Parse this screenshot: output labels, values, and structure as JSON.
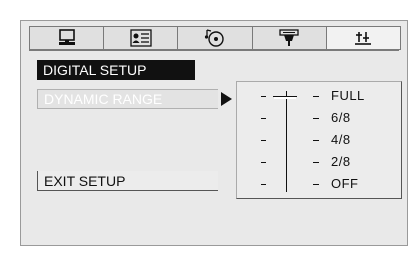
{
  "tabs": [
    {
      "icon": "monitor-icon"
    },
    {
      "icon": "language-card-icon"
    },
    {
      "icon": "disc-audio-icon"
    },
    {
      "icon": "speaker-icon"
    },
    {
      "icon": "equalizer-sliders-icon"
    }
  ],
  "menu": {
    "digital_setup": "DIGITAL SETUP",
    "dynamic_range": "DYNAMIC RANGE",
    "exit_setup": "EXIT SETUP"
  },
  "dynamic_range": {
    "options": [
      "FULL",
      "6/8",
      "4/8",
      "2/8",
      "OFF"
    ],
    "selected": "FULL",
    "level": 1.0
  }
}
